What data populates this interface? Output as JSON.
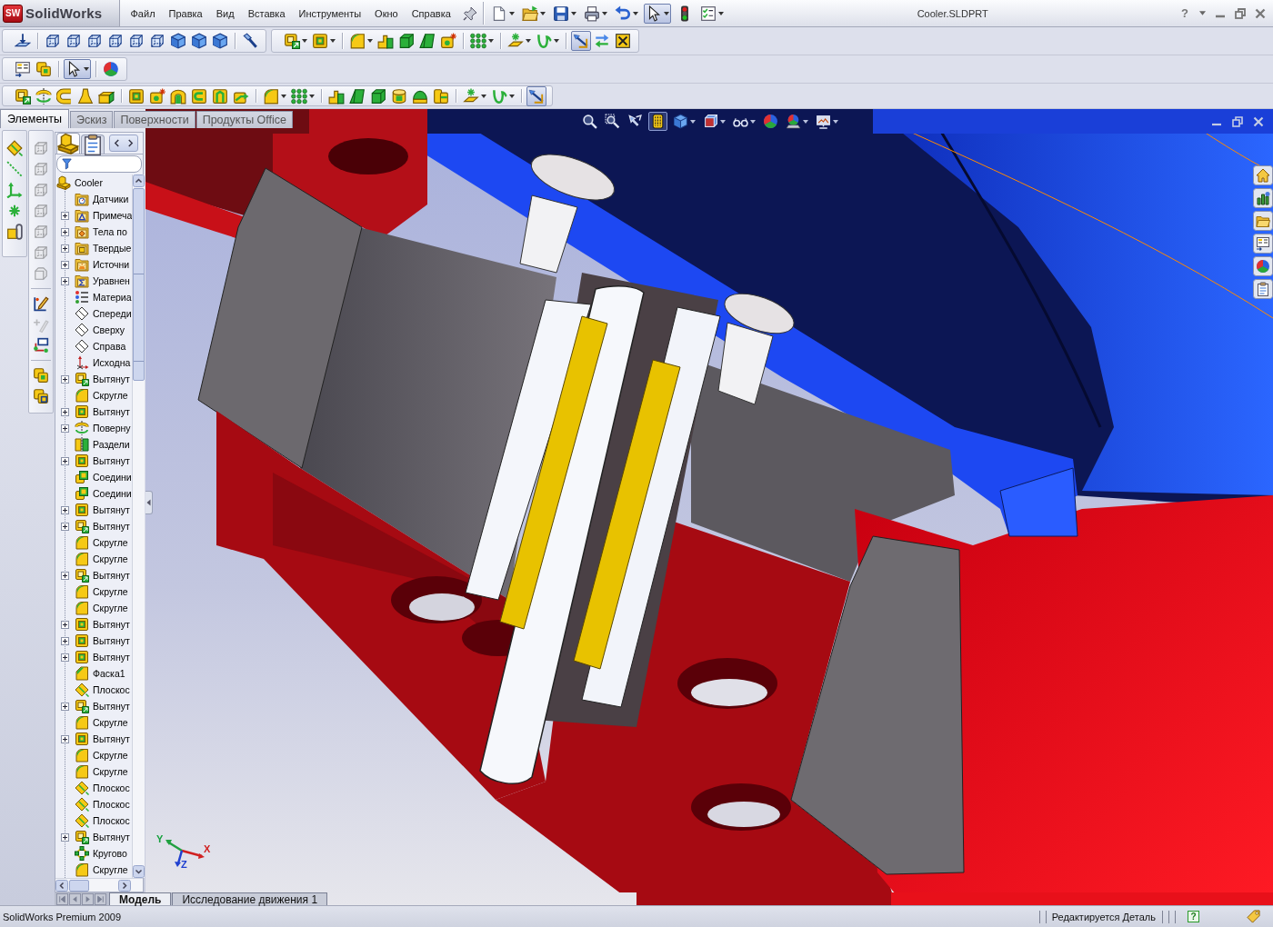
{
  "title_bar": {
    "logo_badge": "SW",
    "logo": "SolidWorks",
    "menu": [
      "Файл",
      "Правка",
      "Вид",
      "Вставка",
      "Инструменты",
      "Окно",
      "Справка"
    ],
    "document": "Cooler.SLDPRT",
    "help": "?"
  },
  "quick_access": [
    {
      "kind": "new",
      "pressed": false,
      "menu": true
    },
    {
      "kind": "open",
      "pressed": false,
      "menu": true
    },
    {
      "kind": "save",
      "pressed": false,
      "menu": true
    },
    {
      "kind": "print",
      "pressed": false,
      "menu": true
    },
    {
      "kind": "undo",
      "pressed": false,
      "menu": true
    },
    {
      "kind": "select",
      "pressed": true,
      "menu": true
    },
    {
      "kind": "rebuild",
      "pressed": false,
      "menu": false
    },
    {
      "kind": "options",
      "pressed": false,
      "menu": true
    }
  ],
  "toolbar_rows": [
    [
      [
        [
          {
            "kind": "normal",
            "pressed": false,
            "menu": false
          }
        ],
        [
          {
            "kind": "wire",
            "pressed": false,
            "menu": false
          },
          {
            "kind": "wire",
            "pressed": false,
            "menu": false
          },
          {
            "kind": "wire",
            "pressed": false,
            "menu": false
          },
          {
            "kind": "wire",
            "pressed": false,
            "menu": false
          },
          {
            "kind": "wire",
            "pressed": false,
            "menu": false
          },
          {
            "kind": "wire",
            "pressed": false,
            "menu": false
          },
          {
            "kind": "cube",
            "pressed": false,
            "menu": false
          },
          {
            "kind": "cube",
            "pressed": false,
            "menu": false
          },
          {
            "kind": "cube",
            "pressed": false,
            "menu": false
          }
        ],
        [
          {
            "kind": "torch",
            "pressed": false,
            "menu": false
          }
        ]
      ],
      [
        [
          {
            "kind": "extrude",
            "pressed": false,
            "menu": true
          },
          {
            "kind": "cut",
            "pressed": false,
            "menu": true
          }
        ],
        [
          {
            "kind": "fillet",
            "pressed": false,
            "menu": true
          },
          {
            "kind": "rib",
            "pressed": false,
            "menu": false
          },
          {
            "kind": "shell",
            "pressed": false,
            "menu": false
          },
          {
            "kind": "draft",
            "pressed": false,
            "menu": false
          },
          {
            "kind": "hole",
            "pressed": false,
            "menu": false
          }
        ],
        [
          {
            "kind": "pattern",
            "pressed": false,
            "menu": true
          }
        ],
        [
          {
            "kind": "refgeom",
            "pressed": false,
            "menu": true
          },
          {
            "kind": "curve",
            "pressed": false,
            "menu": true
          }
        ],
        [
          {
            "kind": "instant3d",
            "pressed": true,
            "menu": false
          },
          {
            "kind": "swap",
            "pressed": false,
            "menu": false
          },
          {
            "kind": "xbox",
            "pressed": false,
            "menu": false
          }
        ]
      ]
    ],
    [
      [
        [
          {
            "kind": "proplist",
            "pressed": false,
            "menu": false
          },
          {
            "kind": "nested",
            "pressed": false,
            "menu": false
          }
        ],
        [
          {
            "kind": "select",
            "pressed": true,
            "menu": true
          }
        ],
        [
          {
            "kind": "appearance",
            "pressed": false,
            "menu": false
          }
        ]
      ]
    ],
    [
      [
        [
          {
            "kind": "extrude",
            "pressed": false,
            "menu": false
          },
          {
            "kind": "revolve",
            "pressed": false,
            "menu": false
          },
          {
            "kind": "sweep",
            "pressed": false,
            "menu": false
          },
          {
            "kind": "loft",
            "pressed": false,
            "menu": false
          },
          {
            "kind": "boundary",
            "pressed": false,
            "menu": false
          }
        ],
        [
          {
            "kind": "cut",
            "pressed": false,
            "menu": false
          },
          {
            "kind": "hole",
            "pressed": false,
            "menu": false
          },
          {
            "kind": "revcut",
            "pressed": false,
            "menu": false
          },
          {
            "kind": "sweptcut",
            "pressed": false,
            "menu": false
          },
          {
            "kind": "loftcut",
            "pressed": false,
            "menu": false
          },
          {
            "kind": "boundcut",
            "pressed": false,
            "menu": false
          }
        ],
        [
          {
            "kind": "fillet",
            "pressed": false,
            "menu": true
          },
          {
            "kind": "pattern",
            "pressed": false,
            "menu": true
          }
        ],
        [
          {
            "kind": "rib",
            "pressed": false,
            "menu": false
          },
          {
            "kind": "draft",
            "pressed": false,
            "menu": false
          },
          {
            "kind": "shell",
            "pressed": false,
            "menu": false
          },
          {
            "kind": "drum",
            "pressed": false,
            "menu": false
          },
          {
            "kind": "dome",
            "pressed": false,
            "menu": false
          },
          {
            "kind": "stack",
            "pressed": false,
            "menu": false
          }
        ],
        [
          {
            "kind": "refgeom",
            "pressed": false,
            "menu": true
          },
          {
            "kind": "curve",
            "pressed": false,
            "menu": true
          }
        ],
        [
          {
            "kind": "instant3d",
            "pressed": true,
            "menu": false
          }
        ]
      ]
    ]
  ],
  "command_tabs": [
    {
      "label": "Элементы",
      "selected": true
    },
    {
      "label": "Эскиз",
      "selected": false
    },
    {
      "label": "Поверхности",
      "selected": false
    },
    {
      "label": "Продукты Office",
      "selected": false
    }
  ],
  "side_toolbars": [
    [
      [
        {
          "kind": "ref-plane",
          "disabled": false
        },
        {
          "kind": "axis",
          "disabled": false
        },
        {
          "kind": "coords",
          "disabled": false
        },
        {
          "kind": "point",
          "disabled": false
        },
        {
          "kind": "mate-ref",
          "disabled": false
        }
      ]
    ],
    [
      [
        {
          "kind": "wire",
          "disabled": true
        },
        {
          "kind": "wire",
          "disabled": true
        },
        {
          "kind": "wire",
          "disabled": true
        },
        {
          "kind": "wire",
          "disabled": true
        },
        {
          "kind": "wire",
          "disabled": true
        },
        {
          "kind": "wire",
          "disabled": true
        },
        {
          "kind": "wire-chamfer",
          "disabled": true
        }
      ],
      [
        {
          "kind": "sketch",
          "disabled": false
        },
        {
          "kind": "add-relation",
          "disabled": true
        },
        {
          "kind": "relations",
          "disabled": false
        }
      ],
      [
        {
          "kind": "nested",
          "disabled": false
        },
        {
          "kind": "nested-square",
          "disabled": false
        }
      ]
    ]
  ],
  "feature_tree": {
    "tabs": [
      {
        "kind": "features",
        "selected": true
      },
      {
        "kind": "properties",
        "selected": false
      }
    ],
    "root": {
      "label": "Cooler",
      "kind": "part",
      "children": [
        {
          "label": "Датчики",
          "kind": "sensors",
          "expandable": false
        },
        {
          "label": "Примеча",
          "kind": "annotations",
          "expandable": true
        },
        {
          "label": "Тела по",
          "kind": "surfaces",
          "expandable": true
        },
        {
          "label": "Твердые",
          "kind": "solids",
          "expandable": true
        },
        {
          "label": "Источни",
          "kind": "lights",
          "expandable": true
        },
        {
          "label": "Уравнен",
          "kind": "equations",
          "expandable": true
        },
        {
          "label": "Материа",
          "kind": "material",
          "expandable": false
        },
        {
          "label": "Спереди",
          "kind": "plane",
          "expandable": false
        },
        {
          "label": "Сверху",
          "kind": "plane",
          "expandable": false
        },
        {
          "label": "Справа",
          "kind": "plane",
          "expandable": false
        },
        {
          "label": "Исходна",
          "kind": "origin",
          "expandable": false
        },
        {
          "label": "Вытянут",
          "kind": "boss",
          "expandable": true
        },
        {
          "label": "Скругле",
          "kind": "fillet",
          "expandable": false
        },
        {
          "label": "Вытянут",
          "kind": "cut",
          "expandable": true
        },
        {
          "label": "Поверну",
          "kind": "revolve",
          "expandable": true
        },
        {
          "label": "Раздели",
          "kind": "split",
          "expandable": false
        },
        {
          "label": "Вытянут",
          "kind": "cut",
          "expandable": true
        },
        {
          "label": "Соедини",
          "kind": "combine",
          "expandable": false
        },
        {
          "label": "Соедини",
          "kind": "combine",
          "expandable": false
        },
        {
          "label": "Вытянут",
          "kind": "cut",
          "expandable": true
        },
        {
          "label": "Вытянут",
          "kind": "boss",
          "expandable": true
        },
        {
          "label": "Скругле",
          "kind": "fillet",
          "expandable": false
        },
        {
          "label": "Скругле",
          "kind": "fillet",
          "expandable": false
        },
        {
          "label": "Вытянут",
          "kind": "boss",
          "expandable": true
        },
        {
          "label": "Скругле",
          "kind": "fillet",
          "expandable": false
        },
        {
          "label": "Скругле",
          "kind": "fillet",
          "expandable": false
        },
        {
          "label": "Вытянут",
          "kind": "cut",
          "expandable": true
        },
        {
          "label": "Вытянут",
          "kind": "cut",
          "expandable": true
        },
        {
          "label": "Вытянут",
          "kind": "cut",
          "expandable": true
        },
        {
          "label": "Фаска1",
          "kind": "chamfer",
          "expandable": false
        },
        {
          "label": "Плоскос",
          "kind": "ref-plane",
          "expandable": false
        },
        {
          "label": "Вытянут",
          "kind": "boss",
          "expandable": true
        },
        {
          "label": "Скругле",
          "kind": "fillet",
          "expandable": false
        },
        {
          "label": "Вытянут",
          "kind": "cut",
          "expandable": true
        },
        {
          "label": "Скругле",
          "kind": "fillet",
          "expandable": false
        },
        {
          "label": "Скругле",
          "kind": "fillet",
          "expandable": false
        },
        {
          "label": "Плоскос",
          "kind": "ref-plane",
          "expandable": false
        },
        {
          "label": "Плоскос",
          "kind": "ref-plane",
          "expandable": false
        },
        {
          "label": "Плоскос",
          "kind": "ref-plane",
          "expandable": false
        },
        {
          "label": "Вытянут",
          "kind": "boss",
          "expandable": true
        },
        {
          "label": "Кругово",
          "kind": "circular-pattern",
          "expandable": false
        },
        {
          "label": "Скругле",
          "kind": "fillet",
          "expandable": false
        }
      ]
    }
  },
  "heads_up": [
    {
      "kind": "zoom-fit",
      "pressed": false,
      "menu": false
    },
    {
      "kind": "zoom-area",
      "pressed": false,
      "menu": false
    },
    {
      "kind": "previous",
      "pressed": false,
      "menu": false
    },
    {
      "kind": "section",
      "pressed": true,
      "menu": false
    },
    {
      "kind": "orientation",
      "pressed": false,
      "menu": true
    },
    {
      "kind": "display-style",
      "pressed": false,
      "menu": true
    },
    {
      "kind": "hide-show",
      "pressed": false,
      "menu": true
    },
    {
      "kind": "appearance",
      "pressed": false,
      "menu": false
    },
    {
      "kind": "scene",
      "pressed": false,
      "menu": true
    },
    {
      "kind": "view-settings",
      "pressed": false,
      "menu": true
    }
  ],
  "triad": [
    "Y",
    "X",
    "Z"
  ],
  "bottom_tabs": [
    {
      "label": "Модель",
      "selected": true
    },
    {
      "label": "Исследование движения 1",
      "selected": false
    }
  ],
  "status_bar": {
    "product": "SolidWorks Premium 2009",
    "mode": "Редактируется Деталь",
    "help": "?"
  }
}
